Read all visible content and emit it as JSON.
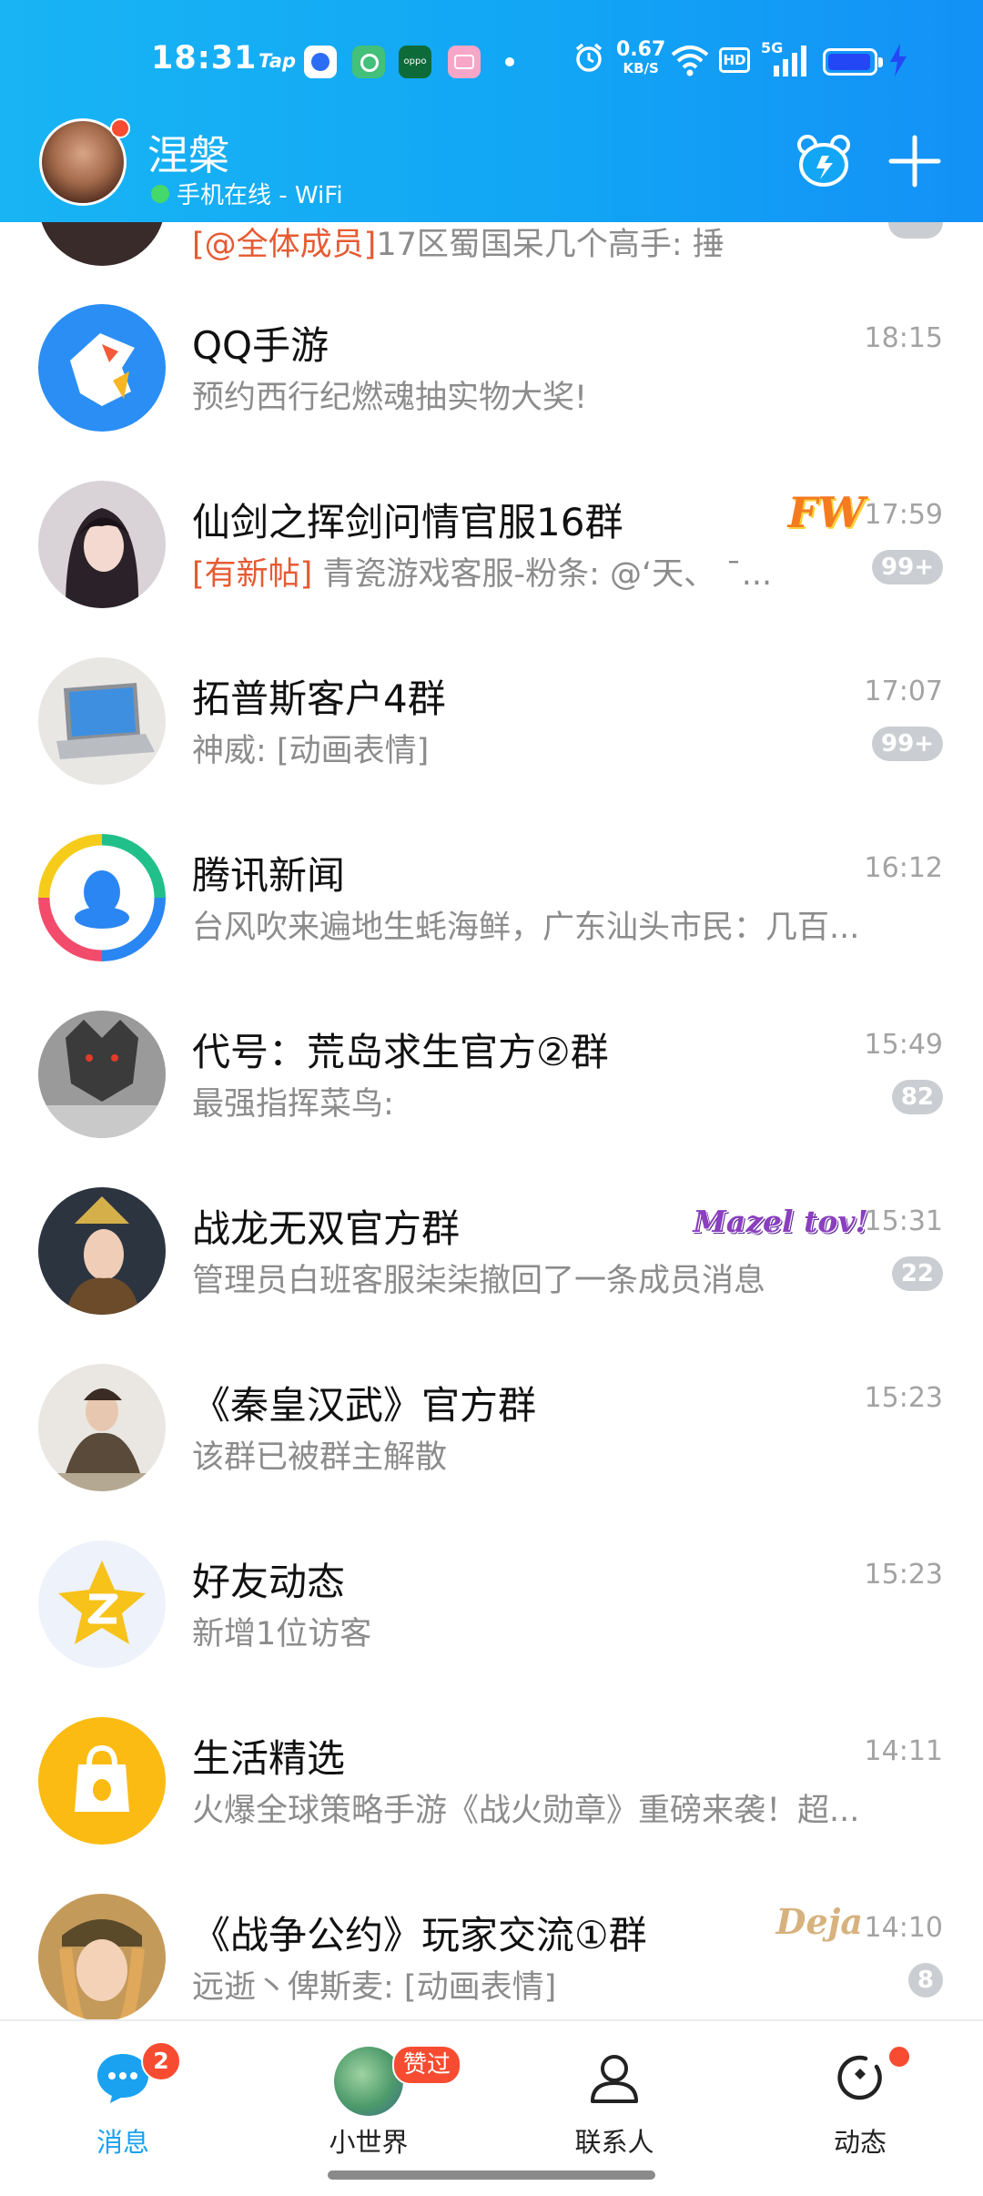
{
  "status_bar": {
    "time": "18:31",
    "app_tap": "Tap",
    "app_oppo": "oppo",
    "net_speed_value": "0.67",
    "net_speed_unit": "KB/S",
    "hd": "HD",
    "network": "5G",
    "battery_level": 0.95
  },
  "header": {
    "nickname": "涅槃",
    "online_status": "手机在线 - WiFi",
    "accent_color": "#12a6f5"
  },
  "partial_row": {
    "tag": "[@全体成员]",
    "preview": "17区蜀国呆几个高手: 捶"
  },
  "chats": [
    {
      "title": "QQ手游",
      "preview": "预约西行纪燃魂抽实物大奖!",
      "time": "18:15",
      "badge": ""
    },
    {
      "title": "仙剑之挥剑问情官服16群",
      "tag": "[有新帖]",
      "preview": "青瓷游戏客服-粉条: @‘天、 ¯...",
      "time": "17:59",
      "badge": "99+",
      "medal": "FW"
    },
    {
      "title": "拓普斯客户4群",
      "preview": "神威: [动画表情]",
      "time": "17:07",
      "badge": "99+"
    },
    {
      "title": "腾讯新闻",
      "preview": "台风吹来遍地生蚝海鲜，广东汕头市民：几百...",
      "time": "16:12",
      "badge": ""
    },
    {
      "title": "代号：荒岛求生官方②群",
      "preview": "最强指挥菜鸟:",
      "time": "15:49",
      "badge": "82"
    },
    {
      "title": "战龙无双官方群",
      "preview": "管理员白班客服柒柒撤回了一条成员消息",
      "time": "15:31",
      "badge": "22",
      "medal": "Mazel tov!"
    },
    {
      "title": "《秦皇汉武》官方群",
      "preview": "该群已被群主解散",
      "time": "15:23",
      "badge": ""
    },
    {
      "title": "好友动态",
      "preview": "新增1位访客",
      "time": "15:23",
      "badge": ""
    },
    {
      "title": "生活精选",
      "preview": "火爆全球策略手游《战火勋章》重磅来袭！超...",
      "time": "14:11",
      "badge": ""
    },
    {
      "title": "《战争公约》玩家交流①群",
      "preview": "远逝丶俾斯麦: [动画表情]",
      "time": "14:10",
      "badge": "8",
      "medal": "Deja"
    }
  ],
  "tabbar": {
    "messages": {
      "label": "消息",
      "badge": "2"
    },
    "world": {
      "label": "小世界",
      "badge": "赞过"
    },
    "contacts": {
      "label": "联系人"
    },
    "moments": {
      "label": "动态"
    }
  }
}
